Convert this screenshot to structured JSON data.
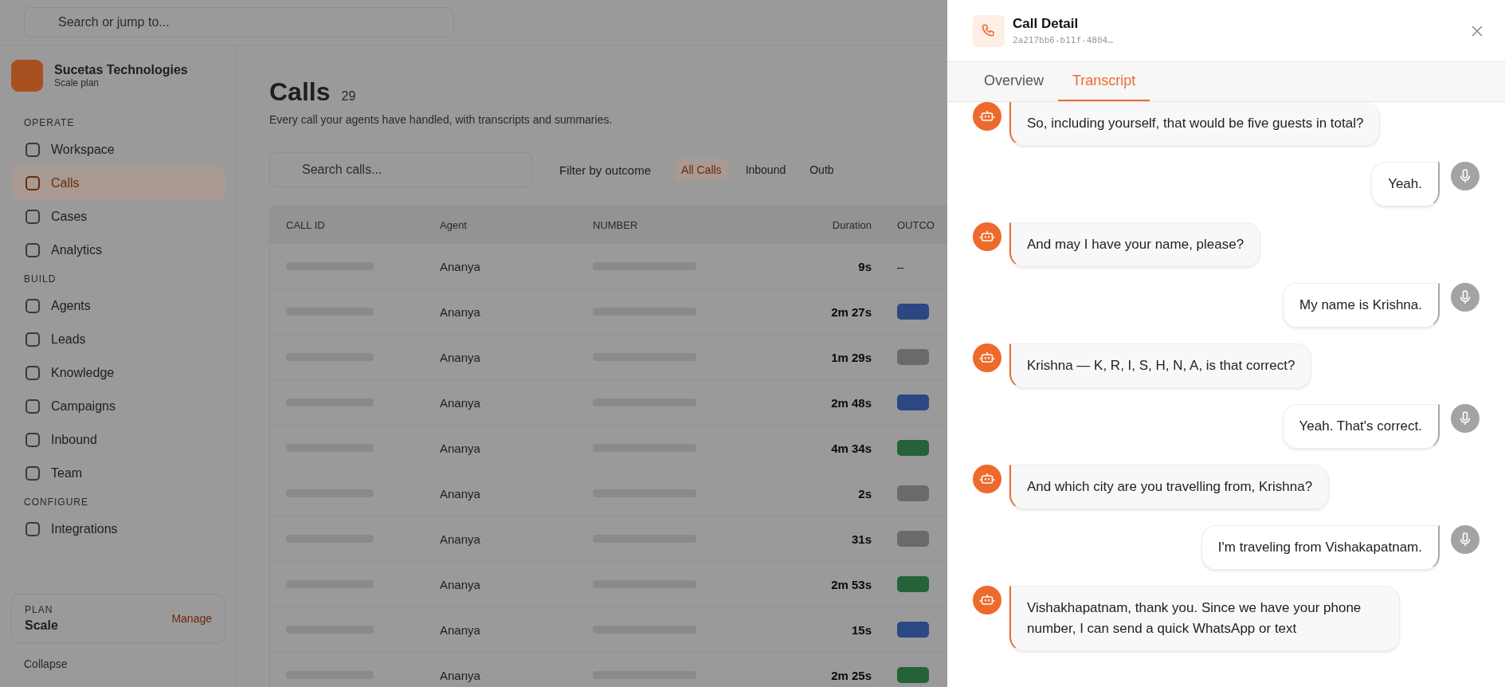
{
  "app": {
    "search": {
      "placeholder": "Search or jump to..."
    },
    "org": {
      "name": "Sucetas Technologies",
      "plan": "Scale plan"
    },
    "nav": [
      {
        "section": "OPERATE",
        "items": [
          {
            "label": "Workspace",
            "selected": false
          },
          {
            "label": "Calls",
            "selected": true
          },
          {
            "label": "Cases",
            "selected": false
          },
          {
            "label": "Analytics",
            "selected": false
          }
        ]
      },
      {
        "section": "BUILD",
        "items": [
          {
            "label": "Agents",
            "selected": false
          },
          {
            "label": "Leads",
            "selected": false
          },
          {
            "label": "Knowledge",
            "selected": false
          },
          {
            "label": "Campaigns",
            "selected": false
          },
          {
            "label": "Inbound",
            "selected": false
          },
          {
            "label": "Team",
            "selected": false
          }
        ]
      },
      {
        "section": "CONFIGURE",
        "items": [
          {
            "label": "Integrations",
            "selected": false
          }
        ]
      }
    ],
    "plan_card": {
      "label": "PLAN",
      "plan": "Scale",
      "action": "Manage"
    },
    "collapse": "Collapse",
    "page": {
      "title": "Calls",
      "count": "29",
      "subtitle": "Every call your agents have handled, with transcripts and summaries."
    },
    "toolbar": {
      "search_placeholder": "Search calls...",
      "filter": "Filter by outcome",
      "segments": [
        {
          "label": "All Calls",
          "selected": true
        },
        {
          "label": "Inbound",
          "selected": false
        },
        {
          "label": "Outb",
          "selected": false
        }
      ]
    },
    "table": {
      "columns": [
        "CALL ID",
        "Agent",
        "NUMBER",
        "Duration",
        "OUTCO"
      ],
      "rows": [
        {
          "agent": "Ananya",
          "duration": "9s",
          "outcome": "–"
        },
        {
          "agent": "Ananya",
          "duration": "2m 27s",
          "color": "#2c4882"
        },
        {
          "agent": "Ananya",
          "duration": "1m 29s",
          "color": "#6a6a6a"
        },
        {
          "agent": "Ananya",
          "duration": "2m 48s",
          "color": "#2c4882"
        },
        {
          "agent": "Ananya",
          "duration": "4m 34s",
          "color": "#266237"
        },
        {
          "agent": "Ananya",
          "duration": "2s",
          "color": "#6a6a6a"
        },
        {
          "agent": "Ananya",
          "duration": "31s",
          "color": "#6a6a6a"
        },
        {
          "agent": "Ananya",
          "duration": "2m 53s",
          "color": "#266237"
        },
        {
          "agent": "Ananya",
          "duration": "15s",
          "color": "#2c4882"
        },
        {
          "agent": "Ananya",
          "duration": "2m 25s",
          "color": "#266237"
        }
      ]
    }
  },
  "panel": {
    "title": "Call Detail",
    "call_id": "2a217bb6-b11f-4804…",
    "tabs": [
      {
        "label": "Overview",
        "selected": false
      },
      {
        "label": "Transcript",
        "selected": true
      }
    ],
    "messages": [
      {
        "kind": "agent",
        "text": "So, including yourself, that would be five guests in total?"
      },
      {
        "kind": "caller",
        "text": "Yeah."
      },
      {
        "kind": "agent",
        "text": "And may I have your name, please?"
      },
      {
        "kind": "caller",
        "text": "My name is Krishna."
      },
      {
        "kind": "agent",
        "text": "Krishna — K, R, I, S, H, N, A, is that correct?"
      },
      {
        "kind": "caller",
        "text": "Yeah. That's correct."
      },
      {
        "kind": "agent",
        "text": "And which city are you travelling from, Krishna?"
      },
      {
        "kind": "caller",
        "text": "I'm traveling from Vishakapatnam."
      },
      {
        "kind": "agent",
        "text": "Vishakhapatnam, thank you. Since we have your phone number, I can send a quick WhatsApp or text"
      }
    ]
  }
}
